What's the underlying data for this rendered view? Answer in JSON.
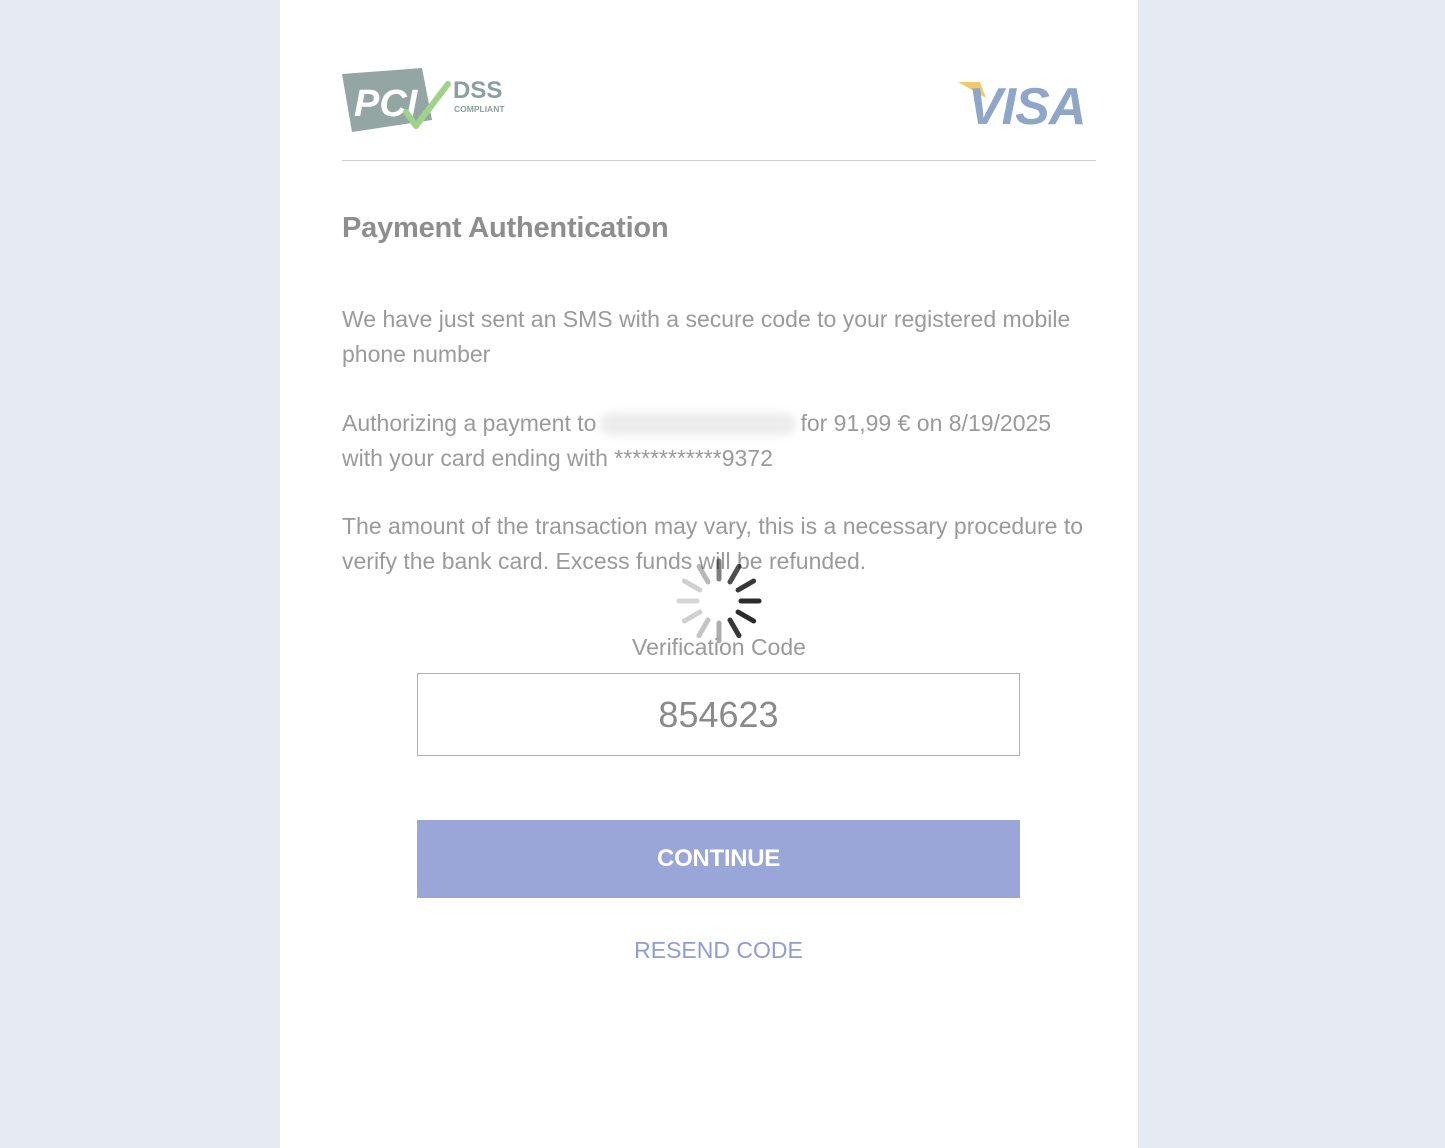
{
  "colors": {
    "page_background": "#e6eaf3",
    "card_background": "#ffffff",
    "text_muted": "#9a9a9a",
    "accent": "#9aa6d8",
    "link": "#8f9cd6",
    "visa_blue": "#8fa6c9",
    "visa_gold": "#f0c96a",
    "pci_gray": "#93a6a4",
    "pci_check": "#9fd28a"
  },
  "header": {
    "pci_logo": {
      "icon": "pci-dss-compliant-logo",
      "text_pci": "PCI",
      "text_dss": "DSS",
      "text_compliant": "COMPLIANT"
    },
    "visa_logo": {
      "icon": "visa-logo",
      "text": "VISA"
    }
  },
  "title": "Payment Authentication",
  "message_sms": "We have just sent an SMS with a secure code to your registered mobile phone number",
  "authorization": {
    "prefix": "Authorizing a payment to",
    "amount_text": "for 91,99  € on 8/19/2025",
    "card_text": "with your card ending with ************9372"
  },
  "notice": "The amount of the transaction may vary, this is a necessary procedure to verify the bank card. Excess funds will be refunded.",
  "spinner_icon": "loading-spinner-icon",
  "verification": {
    "label": "Verification Code",
    "value": "854623"
  },
  "continue_label": "CONTINUE",
  "resend_label": "RESEND CODE"
}
